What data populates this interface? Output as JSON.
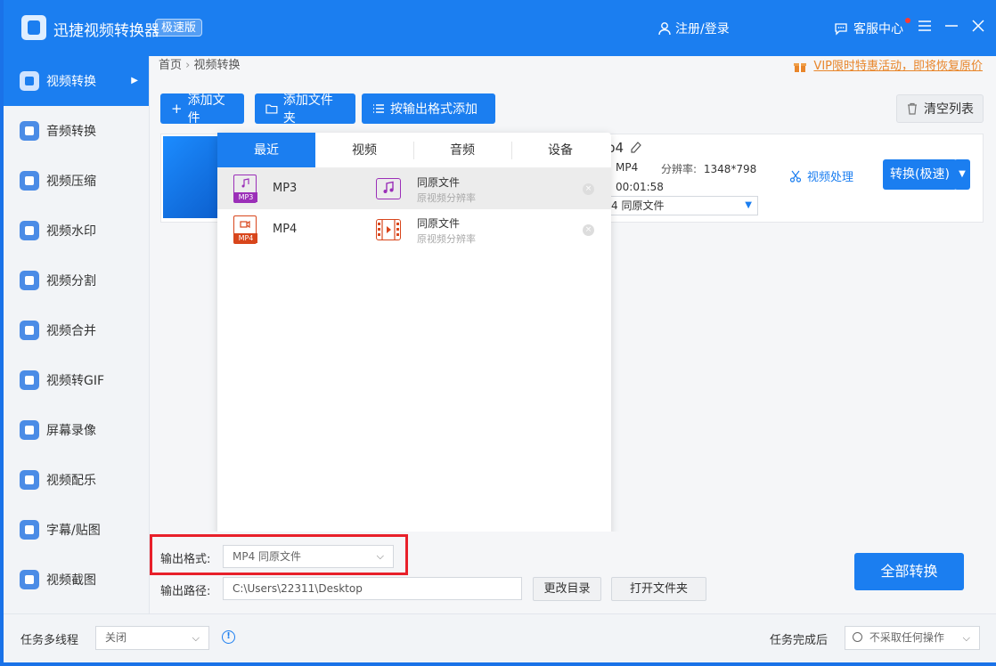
{
  "app": {
    "title": "迅捷视频转换器",
    "edition": "极速版",
    "login_label": "注册/登录",
    "support_label": "客服中心"
  },
  "sidebar": {
    "items": [
      {
        "label": "视频转换",
        "active": true
      },
      {
        "label": "音频转换"
      },
      {
        "label": "视频压缩"
      },
      {
        "label": "视频水印"
      },
      {
        "label": "视频分割"
      },
      {
        "label": "视频合并"
      },
      {
        "label": "视频转GIF"
      },
      {
        "label": "屏幕录像"
      },
      {
        "label": "视频配乐"
      },
      {
        "label": "字幕/贴图"
      },
      {
        "label": "视频截图"
      }
    ]
  },
  "breadcrumb": {
    "home": "首页",
    "sep": "›",
    "current": "视频转换"
  },
  "vip_link": "VIP限时特惠活动，即将恢复原价",
  "toolbar": {
    "add_file": "添加文件",
    "add_folder": "添加文件夹",
    "add_by_format": "按输出格式添加",
    "clear_list": "清空列表"
  },
  "file_item": {
    "name_fragment": "p4",
    "format": "MP4",
    "resolution_label": "分辨率:",
    "resolution": "1348*798",
    "duration": "00:01:58",
    "output_format": "4  同原文件",
    "video_process": "视频处理",
    "convert": "转换(极速)"
  },
  "format_popup": {
    "tabs": [
      "最近",
      "视频",
      "音频",
      "设备"
    ],
    "active_tab": 0,
    "rows": [
      {
        "format": "MP3",
        "preset": "同原文件",
        "sub": "原视频分辨率",
        "color": "#9b2fb8",
        "selected": true
      },
      {
        "format": "MP4",
        "preset": "同原文件",
        "sub": "原视频分辨率",
        "color": "#d8461c",
        "selected": false
      }
    ]
  },
  "output": {
    "format_label": "输出格式:",
    "format_value": "MP4  同原文件",
    "path_label": "输出路径:",
    "path_value": "C:\\Users\\22311\\Desktop",
    "change_dir": "更改目录",
    "open_folder": "打开文件夹",
    "convert_all": "全部转换"
  },
  "status": {
    "multithread_label": "任务多线程",
    "multithread_value": "关闭",
    "after_label": "任务完成后",
    "after_value": "不采取任何操作"
  },
  "colors": {
    "primary": "#1b7ef0",
    "vip": "#e8862b",
    "highlight": "#e8202a"
  }
}
